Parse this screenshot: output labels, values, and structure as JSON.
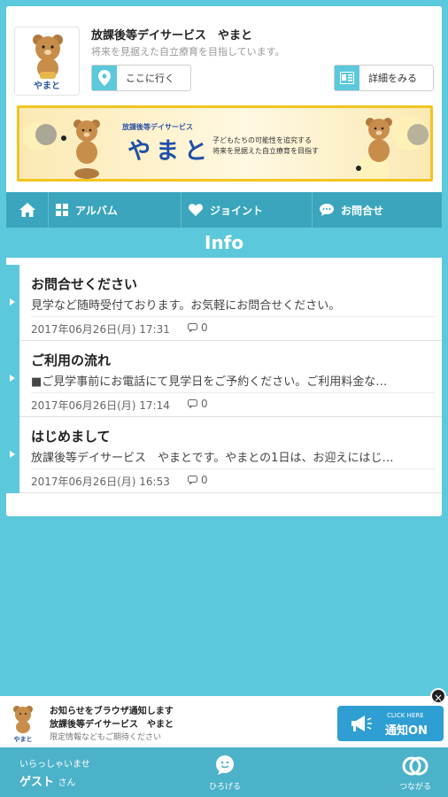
{
  "header": {
    "logo_text": "やまと",
    "shop_name": "放課後等デイサービス　やまと",
    "shop_sub": "将来を見据えた自立療育を目指しています。",
    "go_button": "ここに行く",
    "detail_button": "詳細をみる"
  },
  "banner": {
    "small": "放課後等デイサービス",
    "title": "やまと",
    "line1": "子どもたちの可能性を追究する",
    "line2": "将来を見据えた自立療育を目指す"
  },
  "nav": {
    "album": "アルバム",
    "joint": "ジョイント",
    "contact": "お問合せ"
  },
  "section_title": "Info",
  "posts": [
    {
      "title": "お問合せください",
      "body": "見学など随時受付ております。お気軽にお問合せください。",
      "date": "2017年06月26日(月) 17:31",
      "comments": "0"
    },
    {
      "title": "ご利用の流れ",
      "body": "■ご見学事前にお電話にて見学日をご予約ください。ご利用料金な…",
      "date": "2017年06月26日(月) 17:14",
      "comments": "0"
    },
    {
      "title": "はじめまして",
      "body": "放課後等デイサービス　やまとです。やまとの1日は、お迎えにはじ…",
      "date": "2017年06月26日(月) 16:53",
      "comments": "0"
    }
  ],
  "notify": {
    "line1": "お知らせをブラウザ通知します",
    "line2": "放課後等デイサービス　やまと",
    "line3": "限定情報などもご期待ください",
    "logo_text": "やまと",
    "btn_small": "CLICK HERE",
    "btn_label": "通知ON",
    "close": "×"
  },
  "bottom": {
    "welcome": "いらっしゃいませ",
    "guest": "ゲスト",
    "guest_suffix": "さん",
    "spread": "ひろげる",
    "connect": "つながる"
  },
  "colors": {
    "background": "#5cc8dc",
    "nav": "#3aa5bd",
    "notify_button": "#2f9fd3",
    "banner_border": "#f2c521"
  }
}
